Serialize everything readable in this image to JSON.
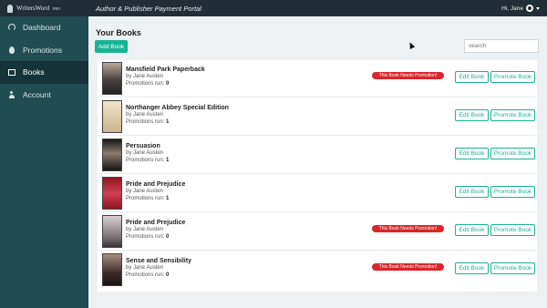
{
  "app": {
    "brand": "WritersWord",
    "brand_sup": "PRO",
    "portal_title": "Author & Publisher Payment Portal",
    "greeting": "Hi, Jane"
  },
  "sidebar": {
    "items": [
      {
        "label": "Dashboard",
        "icon": "dashboard-icon"
      },
      {
        "label": "Promotions",
        "icon": "drop-icon"
      },
      {
        "label": "Books",
        "icon": "book-icon",
        "active": true
      },
      {
        "label": "Account",
        "icon": "user-icon"
      }
    ]
  },
  "main": {
    "title": "Your Books",
    "add_label": "Add Book",
    "search_placeholder": "search"
  },
  "books": [
    {
      "title": "Mansfield Park Paperback",
      "author": "by Jane Austen",
      "runs_label": "Promotions run:",
      "runs": "0",
      "badge": "This Book Needs Promotion!",
      "edit": "Edit Book",
      "promote": "Promote Book",
      "cover_color": "#4a4040",
      "cover_light": "#b8a898"
    },
    {
      "title": "Northanger Abbey Special Edition",
      "author": "by Jane Austen",
      "runs_label": "Promotions run:",
      "runs": "1",
      "badge": "",
      "edit": "Edit Book",
      "promote": "Promote Book",
      "cover_color": "#c9b58a",
      "cover_light": "#efe4c7"
    },
    {
      "title": "Persuasion",
      "author": "by Jane Austen",
      "runs_label": "Promotions run:",
      "runs": "1",
      "badge": "",
      "edit": "Edit Book",
      "promote": "Promote Book",
      "cover_color": "#151515",
      "cover_light": "#8a7a70"
    },
    {
      "title": "Pride and Prejudice",
      "author": "by Jane Austen",
      "runs_label": "Promotions run:",
      "runs": "1",
      "badge": "",
      "edit": "Edit Book",
      "promote": "Promote Book",
      "cover_color": "#8e1620",
      "cover_light": "#d04050"
    },
    {
      "title": "Pride and Prejudice",
      "author": "by Jane Austen",
      "runs_label": "Promotions run:",
      "runs": "0",
      "badge": "This Book Needs Promotion!",
      "edit": "Edit Book",
      "promote": "Promote Book",
      "cover_color": "#7a6f72",
      "cover_light": "#d8d0d2"
    },
    {
      "title": "Sense and Sensibility",
      "author": "by Jane Austen",
      "runs_label": "Promotions run:",
      "runs": "0",
      "badge": "This Book Needs Promotion!",
      "edit": "Edit Book",
      "promote": "Promote Book",
      "cover_color": "#3c2c2a",
      "cover_light": "#a89080"
    }
  ]
}
